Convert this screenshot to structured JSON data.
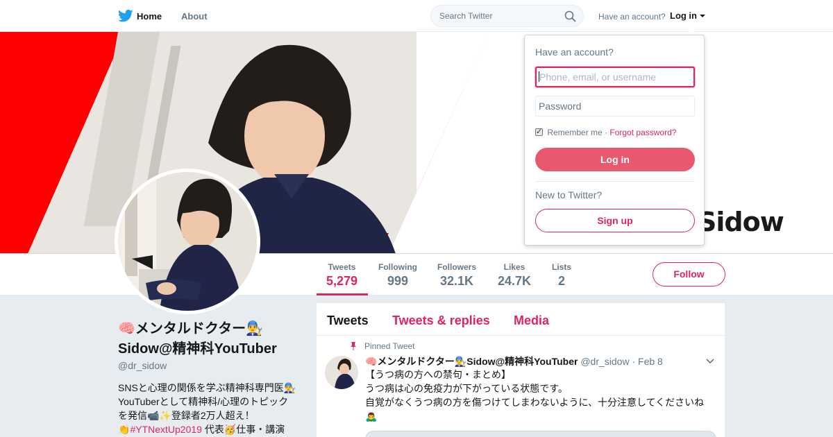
{
  "nav": {
    "home_label": "Home",
    "about_label": "About",
    "search_placeholder": "Search Twitter",
    "have_account": "Have an account?",
    "login_label": "Log in"
  },
  "banner": {
    "overlay_text": "Sidow"
  },
  "profile": {
    "name": "🧠メンタルドクター👨‍🔧Sidow@精神科YouTuber",
    "handle": "@dr_sidow",
    "bio_line1": "SNSと心理の関係を学ぶ精神科専門医👨‍🔧",
    "bio_line2": "YouTuberとして精神科/心理のトピック",
    "bio_line3": "を発信📹✨登録者2万人超え！",
    "bio_line4_prefix": "👏",
    "bio_hashtag": "#YTNextUp2019",
    "bio_line4_suffix": " 代表🥳仕事・講演"
  },
  "stats": [
    {
      "label": "Tweets",
      "value": "5,279"
    },
    {
      "label": "Following",
      "value": "999"
    },
    {
      "label": "Followers",
      "value": "32.1K"
    },
    {
      "label": "Likes",
      "value": "24.7K"
    },
    {
      "label": "Lists",
      "value": "2"
    }
  ],
  "follow_label": "Follow",
  "timeline": {
    "tabs": [
      "Tweets",
      "Tweets & replies",
      "Media"
    ],
    "pinned_label": "Pinned Tweet",
    "tweet": {
      "name": "🧠メンタルドクター👨‍🔧Sidow@精神科YouTuber",
      "handle": "@dr_sidow",
      "date": "Feb 8",
      "line1": "【うつ病の方への禁句・まとめ】",
      "line2": "うつ病は心の免疫力が下がっている状態です。",
      "line3": "自覚がなくうつ病の方を傷つけてしまわないように、十分注意してくださいね",
      "line4": "🙇‍♂️"
    }
  },
  "login_dropdown": {
    "title": "Have an account?",
    "username_placeholder": "Phone, email, or username",
    "password_placeholder": "Password",
    "remember_label": "Remember me",
    "separator": " · ",
    "forgot_label": "Forgot password?",
    "login_button": "Log in",
    "new_to": "New to Twitter?",
    "signup_button": "Sign up"
  },
  "colors": {
    "accent": "#e0245e",
    "banner_red": "#ff0000",
    "login_button": "#e8586f",
    "twitter_blue": "#1da1f2"
  }
}
